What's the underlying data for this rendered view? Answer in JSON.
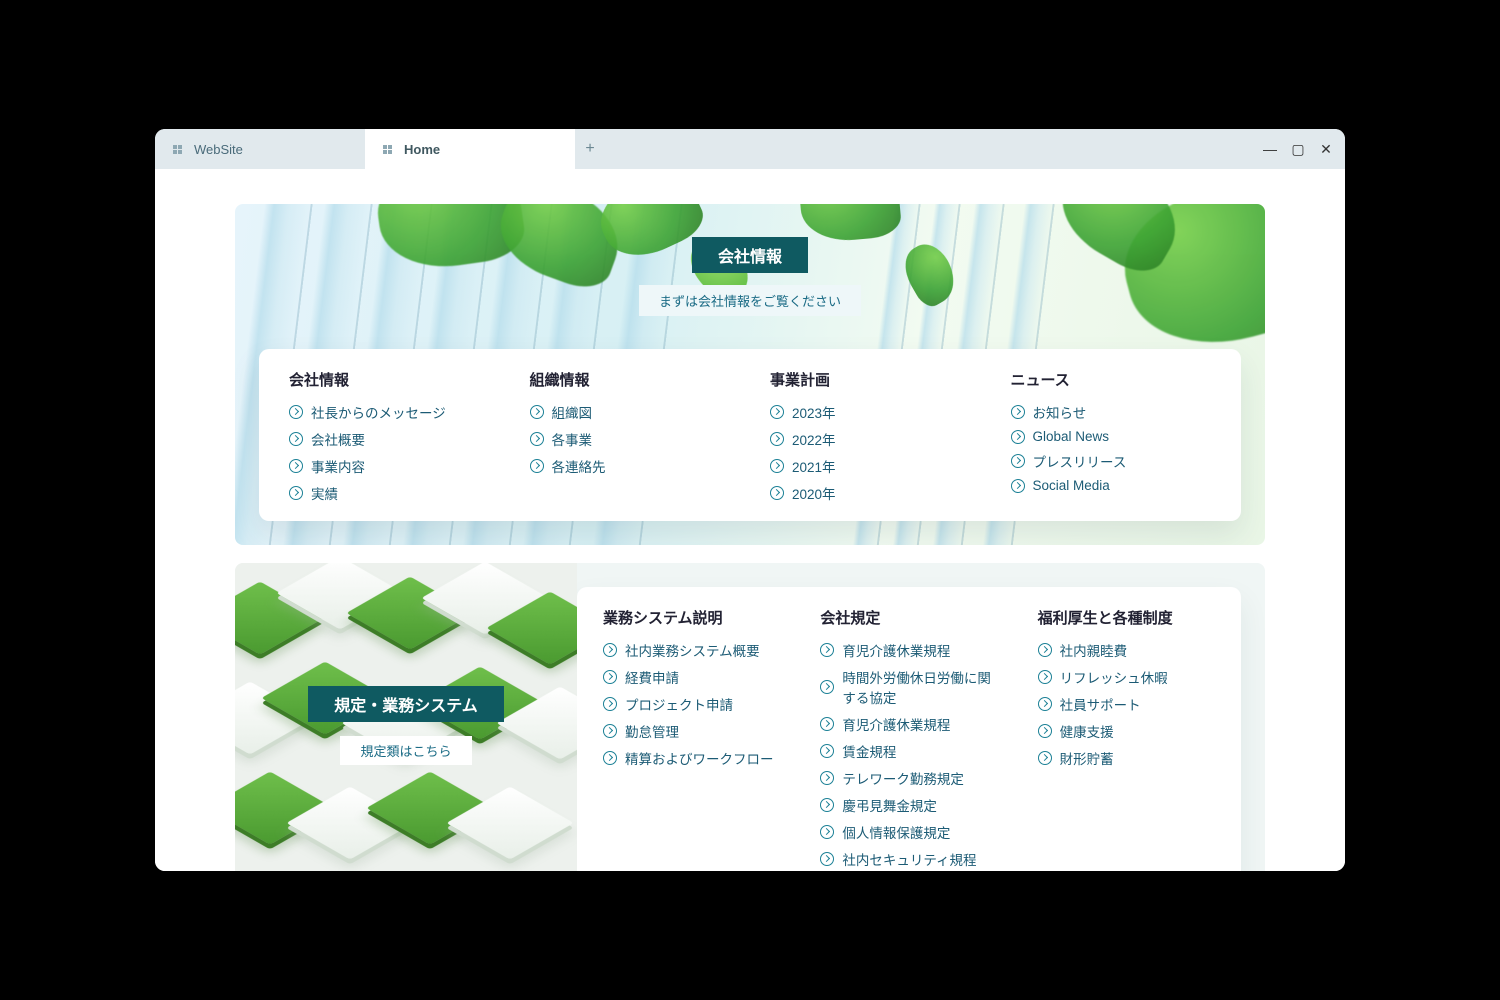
{
  "tabs": [
    {
      "label": "WebSite",
      "active": false
    },
    {
      "label": "Home",
      "active": true
    }
  ],
  "hero": {
    "title": "会社情報",
    "subtitle": "まずは会社情報をご覧ください",
    "columns": [
      {
        "heading": "会社情報",
        "links": [
          "社長からのメッセージ",
          "会社概要",
          "事業内容",
          "実績"
        ]
      },
      {
        "heading": "組織情報",
        "links": [
          "組織図",
          "各事業",
          "各連絡先"
        ]
      },
      {
        "heading": "事業計画",
        "links": [
          "2023年",
          "2022年",
          "2021年",
          "2020年"
        ]
      },
      {
        "heading": "ニュース",
        "links": [
          "お知らせ",
          "Global News",
          "プレスリリース",
          "Social Media"
        ]
      }
    ]
  },
  "section2": {
    "title": "規定・業務システム",
    "subtitle": "規定類はこちら",
    "columns": [
      {
        "heading": "業務システム説明",
        "links": [
          "社内業務システム概要",
          "経費申請",
          "プロジェクト申請",
          "勤怠管理",
          "精算およびワークフロー"
        ]
      },
      {
        "heading": "会社規定",
        "links": [
          "育児介護休業規程",
          "時間外労働休日労働に関する協定",
          "育児介護休業規程",
          "賃金規程",
          "テレワーク勤務規定",
          "慶弔見舞金規定",
          "個人情報保護規定",
          "社内セキュリティ規程"
        ]
      },
      {
        "heading": "福利厚生と各種制度",
        "links": [
          "社内親睦費",
          "リフレッシュ休暇",
          "社員サポート",
          "健康支援",
          "財形貯蓄"
        ]
      }
    ]
  }
}
